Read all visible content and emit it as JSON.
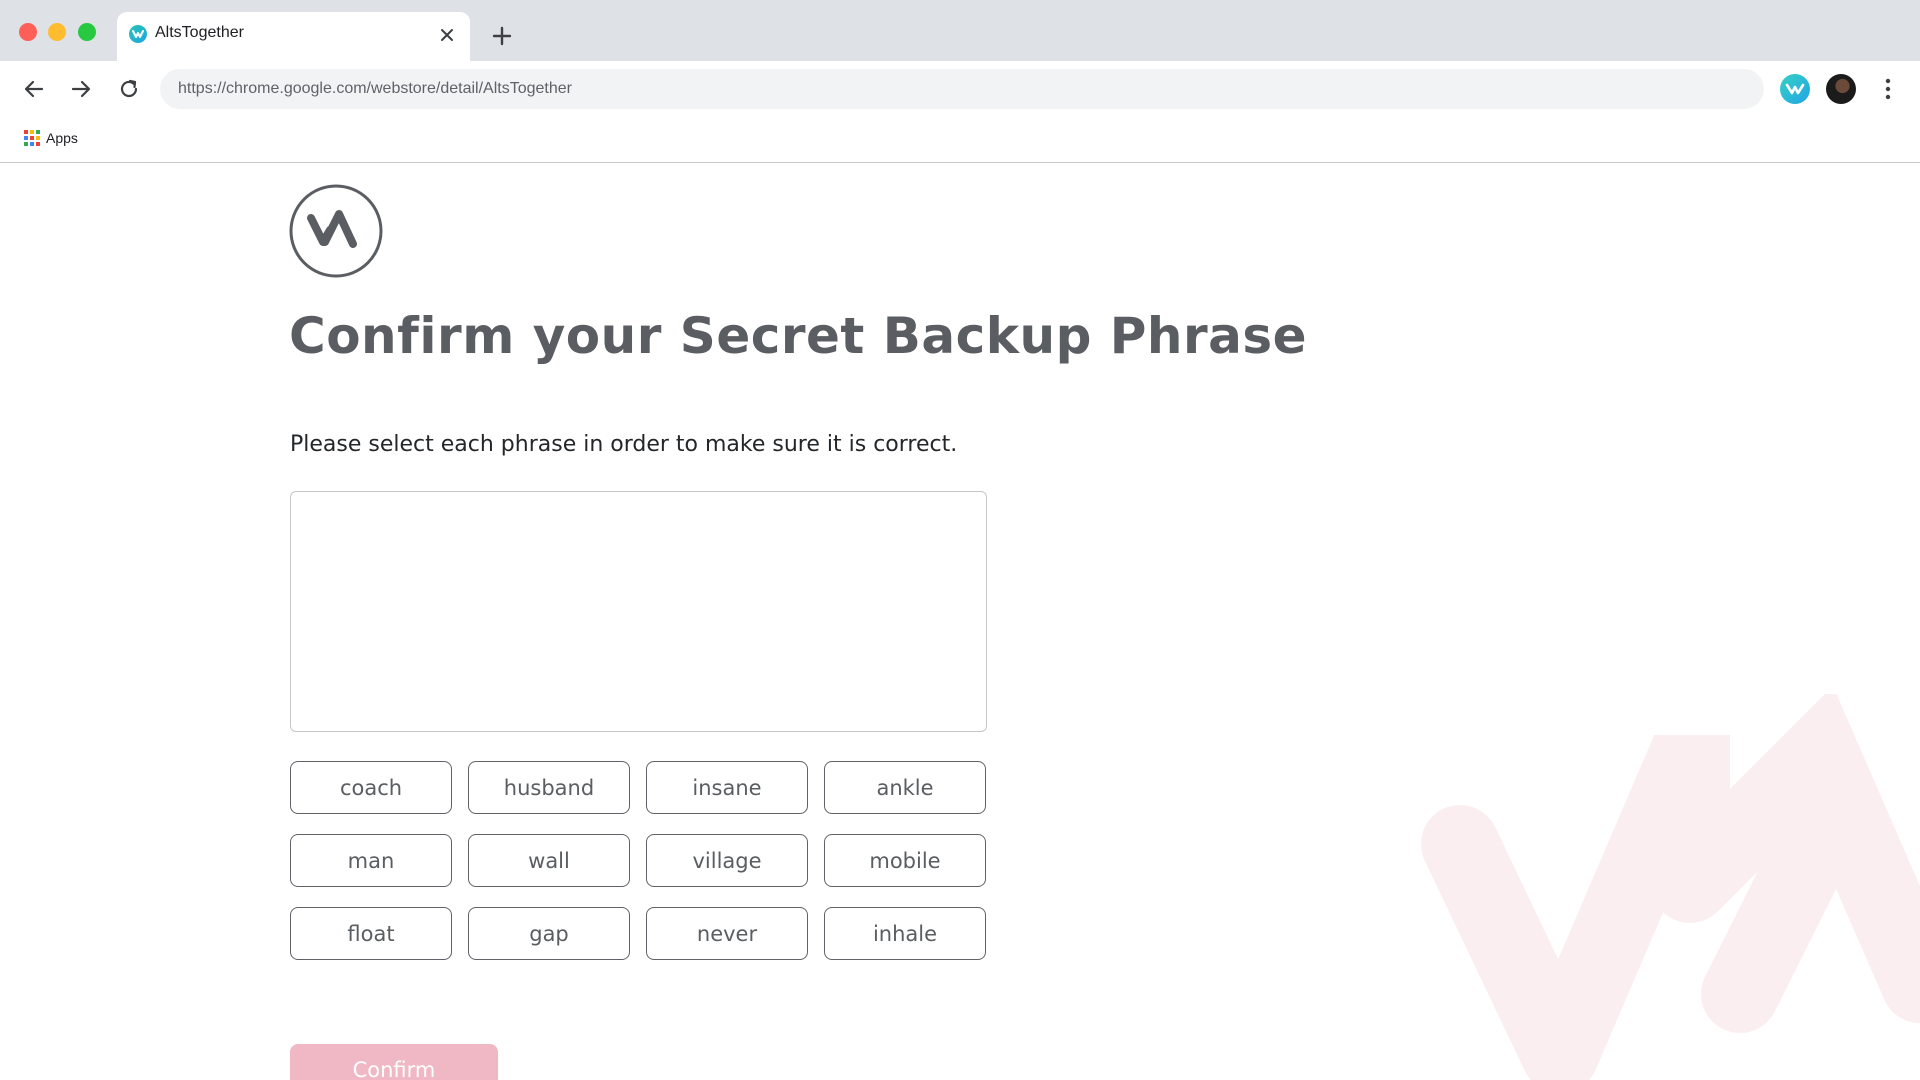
{
  "browser": {
    "tab": {
      "title": "AltsTogether",
      "favicon": "altstogether-logo-icon"
    },
    "address_bar": {
      "url": "https://chrome.google.com/webstore/detail/AltsTogether"
    },
    "bookmarks": {
      "apps_label": "Apps"
    },
    "icons": {
      "back": "back-arrow-icon",
      "forward": "forward-arrow-icon",
      "reload": "reload-icon",
      "new_tab": "plus-icon",
      "close_tab": "close-icon",
      "menu": "more-vert-icon"
    }
  },
  "page": {
    "title": "Confirm your Secret Backup Phrase",
    "instruction": "Please select each phrase in order to make sure it is correct.",
    "words": [
      [
        "coach",
        "husband",
        "insane",
        "ankle"
      ],
      [
        "man",
        "wall",
        "village",
        "mobile"
      ],
      [
        "float",
        "gap",
        "never",
        "inhale"
      ]
    ],
    "confirm_label": "Confirm"
  },
  "colors": {
    "accent_disabled": "#f0b8c5",
    "watermark": "#fbeef0",
    "text_primary": "#5a5d61",
    "tabstrip": "#dee1e6"
  }
}
